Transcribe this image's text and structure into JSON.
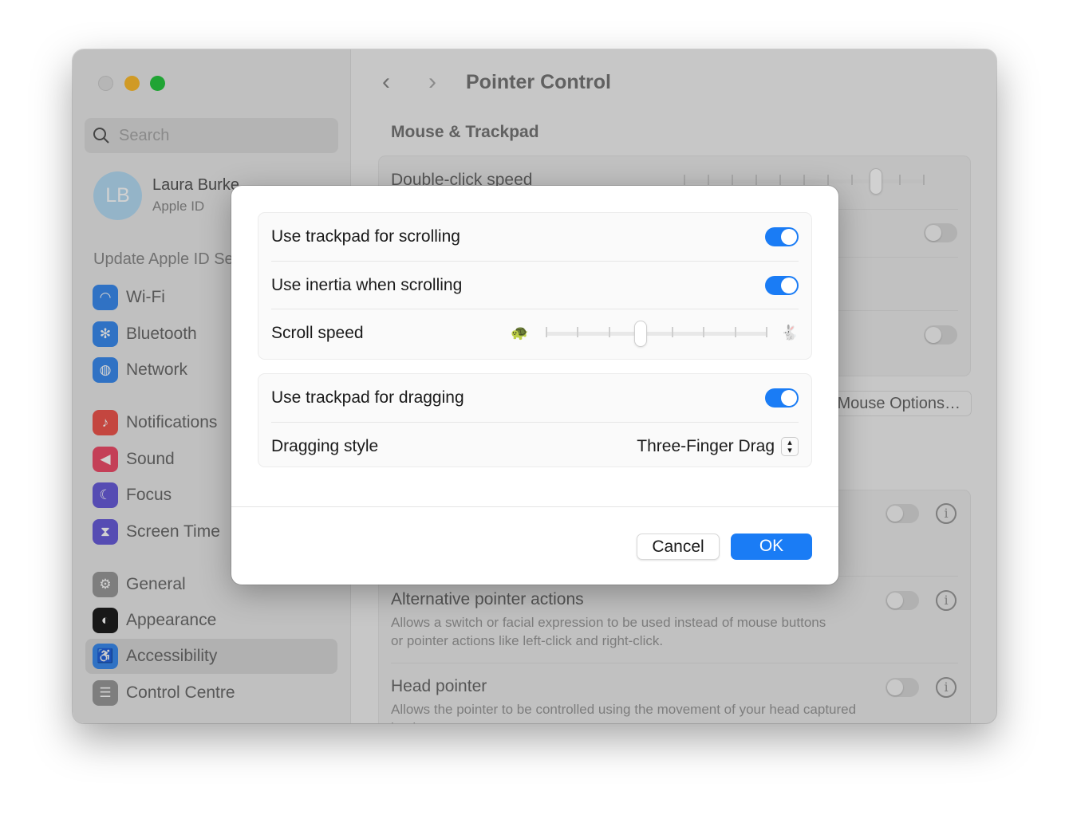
{
  "window": {
    "title": "Pointer Control",
    "traffic_lights": [
      "#dedede",
      "#febc2e",
      "#28c840"
    ]
  },
  "sidebar": {
    "search_placeholder": "Search",
    "user": {
      "initials": "LB",
      "name": "Laura Burke",
      "subtitle": "Apple ID"
    },
    "update_notice": "Update Apple ID Settings",
    "items": [
      {
        "label": "Wi-Fi",
        "icon": "wifi-icon",
        "color": "#3b8cf0",
        "glyph": "◠"
      },
      {
        "label": "Bluetooth",
        "icon": "bluetooth-icon",
        "color": "#3b8cf0",
        "glyph": "✻"
      },
      {
        "label": "Network",
        "icon": "globe-icon",
        "color": "#3b8cf0",
        "glyph": "◍"
      },
      {
        "label": "Notifications",
        "icon": "bell-icon",
        "color": "#f0564d",
        "glyph": "♪"
      },
      {
        "label": "Sound",
        "icon": "speaker-icon",
        "color": "#f04e6b",
        "glyph": "◀"
      },
      {
        "label": "Focus",
        "icon": "moon-icon",
        "color": "#6a5ddb",
        "glyph": "☾"
      },
      {
        "label": "Screen Time",
        "icon": "hourglass-icon",
        "color": "#6a5ddb",
        "glyph": "⧗"
      },
      {
        "label": "General",
        "icon": "gear-icon",
        "color": "#9a9a9a",
        "glyph": "⚙"
      },
      {
        "label": "Appearance",
        "icon": "appearance-icon",
        "color": "#1e1e1e",
        "glyph": "◐"
      },
      {
        "label": "Accessibility",
        "icon": "accessibility-icon",
        "color": "#3b8cf0",
        "glyph": "♿",
        "selected": true
      },
      {
        "label": "Control Centre",
        "icon": "control-centre-icon",
        "color": "#9a9a9a",
        "glyph": "☰"
      }
    ]
  },
  "main": {
    "section": "Mouse & Trackpad",
    "double_click_label": "Double-click speed",
    "double_click_speed": {
      "steps": 11,
      "value_index": 8
    },
    "background_toggles": [
      false,
      false
    ],
    "mouse_options_button": "Mouse Options…",
    "rows": [
      {
        "title": "Alternative pointer actions",
        "desc": "Allows a switch or facial expression to be used instead of mouse buttons or pointer actions like left-click and right-click.",
        "on": false
      },
      {
        "title": "Head pointer",
        "desc": "Allows the pointer to be controlled using the movement of your head captured by the camera.",
        "on": false
      }
    ]
  },
  "dialog": {
    "use_trackpad_scrolling": {
      "label": "Use trackpad for scrolling",
      "on": true
    },
    "use_inertia": {
      "label": "Use inertia when scrolling",
      "on": true
    },
    "scroll_speed": {
      "label": "Scroll speed",
      "steps": 8,
      "value_index": 3
    },
    "use_trackpad_dragging": {
      "label": "Use trackpad for dragging",
      "on": true
    },
    "dragging_style": {
      "label": "Dragging style",
      "value": "Three-Finger Drag"
    },
    "cancel": "Cancel",
    "ok": "OK",
    "accent": "#1a7cf5"
  }
}
